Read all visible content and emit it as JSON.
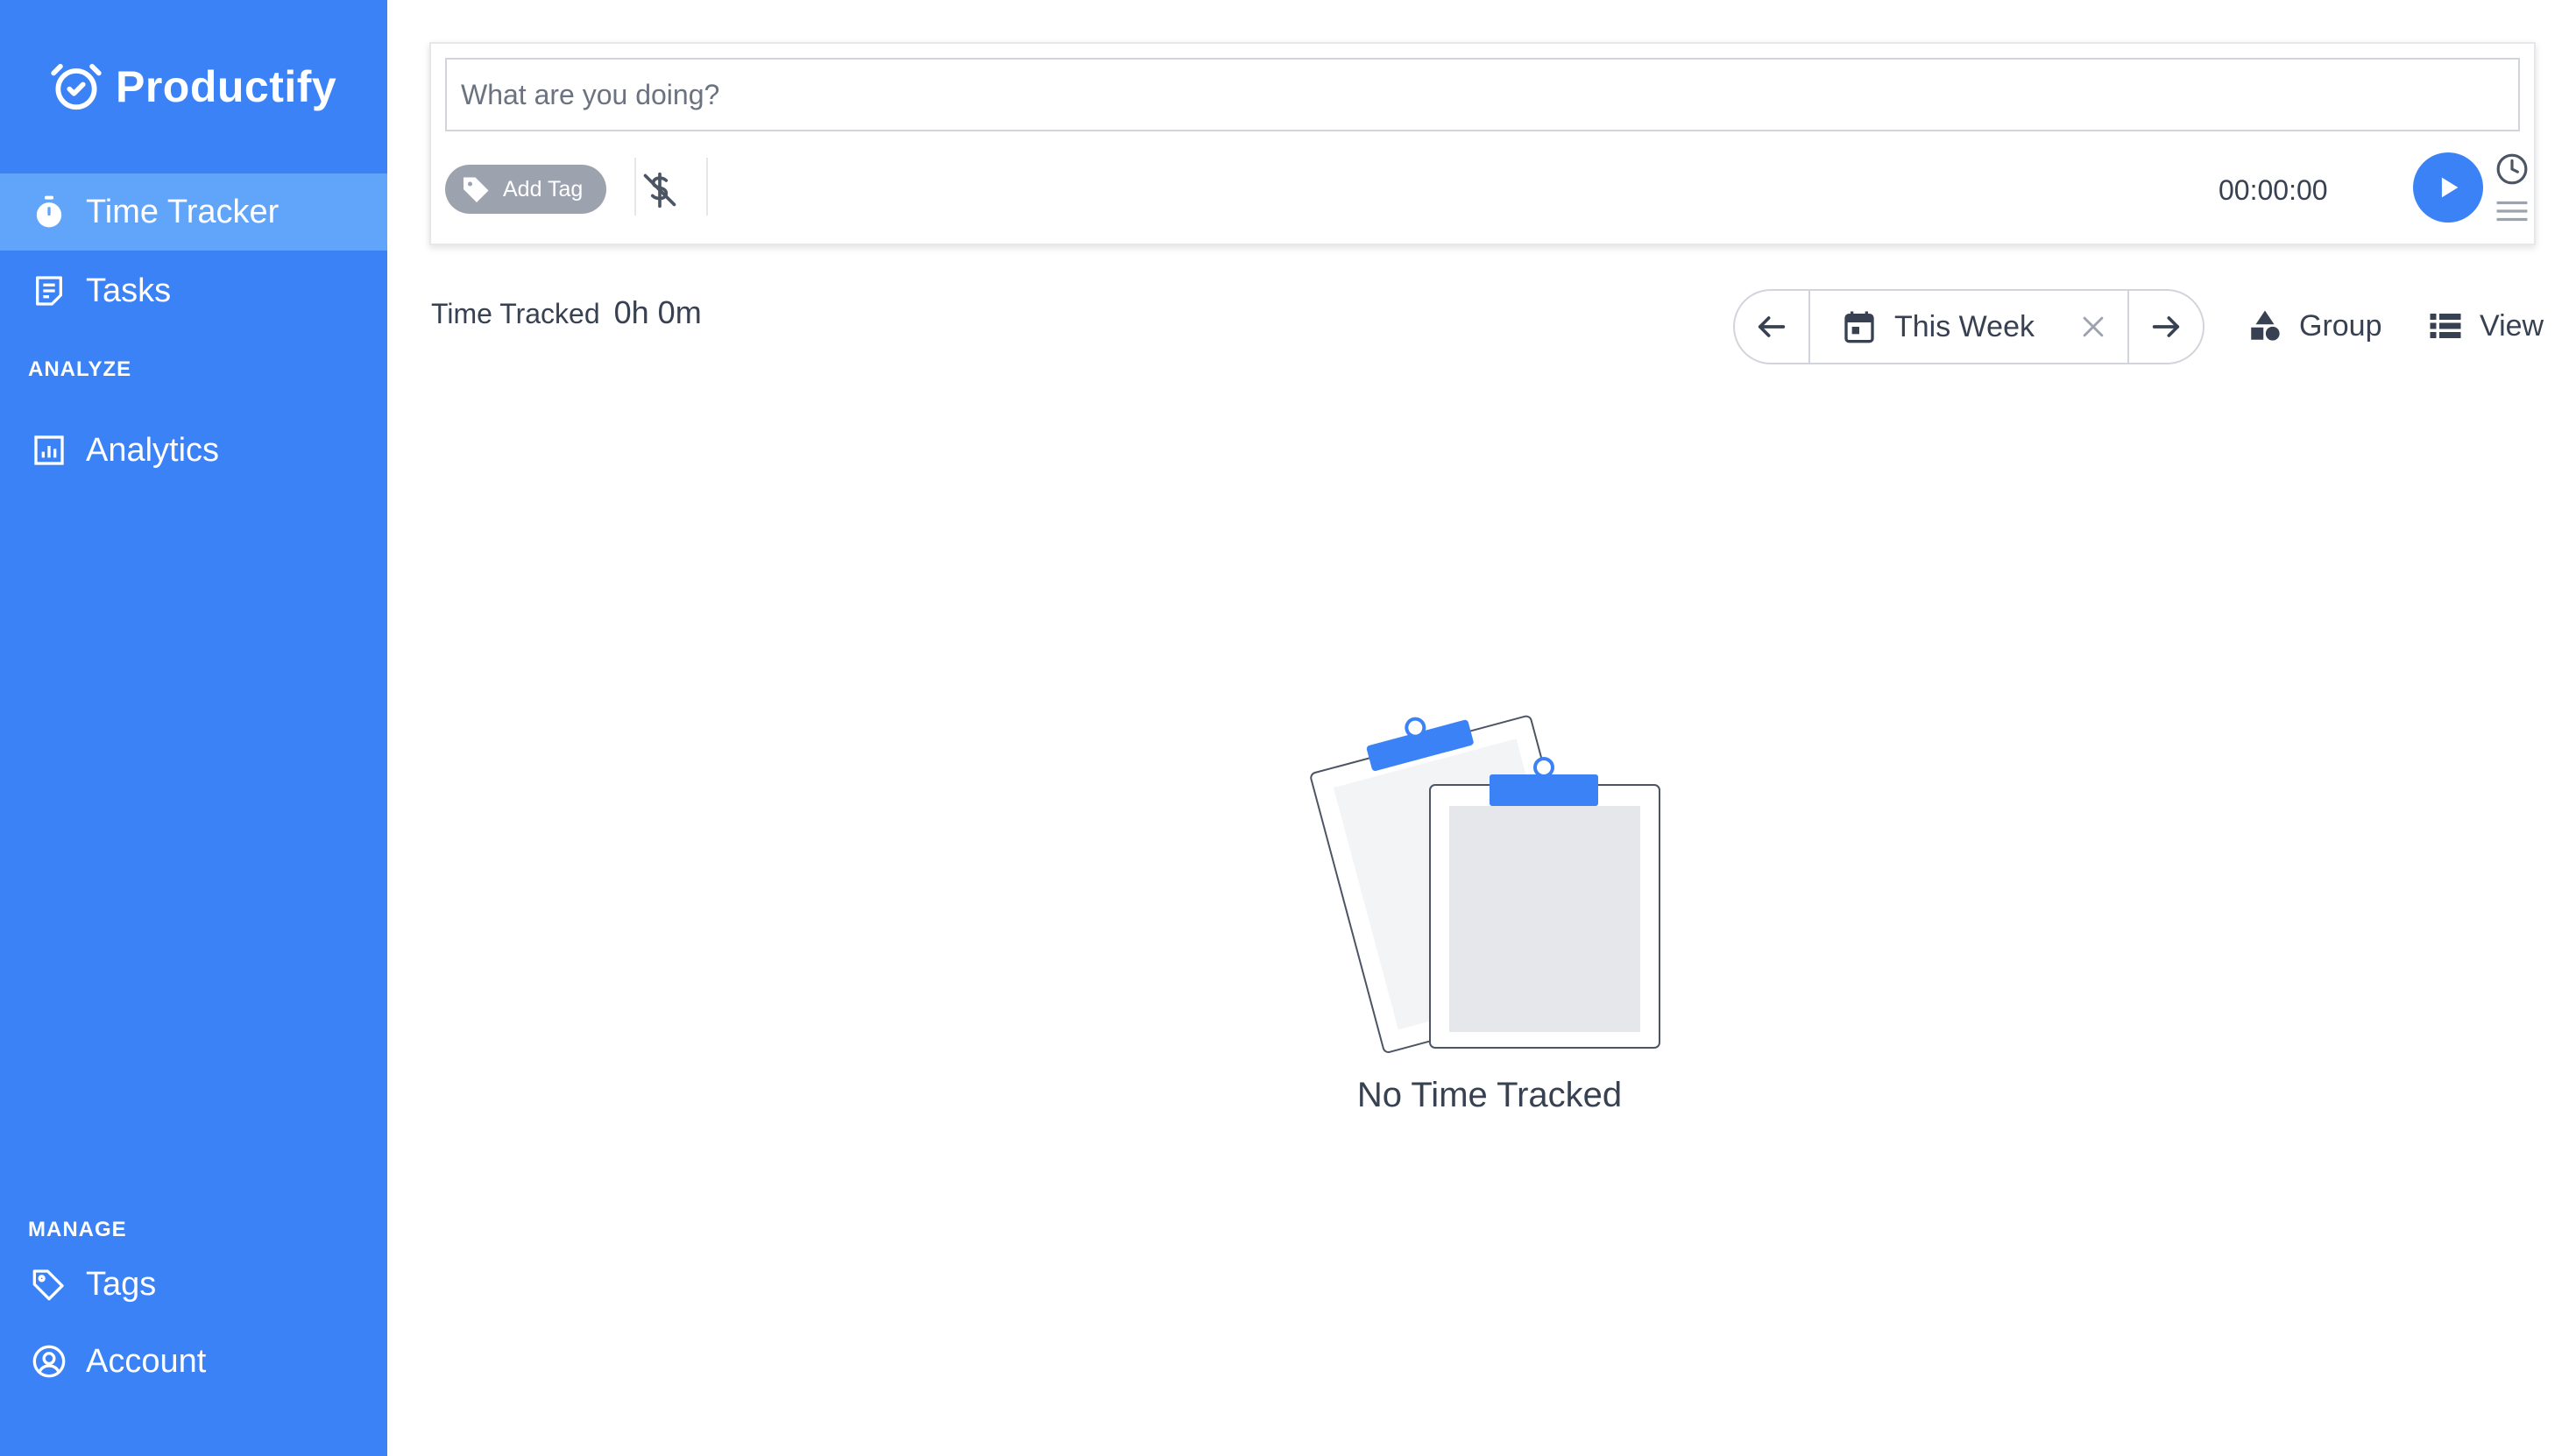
{
  "brand": {
    "name": "Productify",
    "icon": "alarm-clock-check-icon"
  },
  "sidebar": {
    "nav": [
      {
        "label": "Time Tracker",
        "icon": "stopwatch-icon",
        "active": true
      },
      {
        "label": "Tasks",
        "icon": "task-list-icon",
        "active": false
      }
    ],
    "analyze": {
      "heading": "ANALYZE",
      "items": [
        {
          "label": "Analytics",
          "icon": "bar-chart-icon"
        }
      ]
    },
    "manage": {
      "heading": "MANAGE",
      "items": [
        {
          "label": "Tags",
          "icon": "tag-icon"
        },
        {
          "label": "Account",
          "icon": "user-circle-icon"
        }
      ]
    }
  },
  "tracker": {
    "input_placeholder": "What are you doing?",
    "input_value": "",
    "add_tag_label": "Add Tag",
    "billable_icon": "dollar-off-icon",
    "timer": "00:00:00",
    "play_icon": "play-icon",
    "mode_icons": [
      "clock-icon",
      "list-icon"
    ]
  },
  "summary": {
    "tracked_label": "Time Tracked",
    "tracked_value": "0h 0m",
    "range_label": "This Week",
    "group_label": "Group",
    "view_label": "View"
  },
  "empty_state": {
    "message": "No Time Tracked",
    "illustration": "clipboard-illustration"
  },
  "colors": {
    "primary": "#3b82f6",
    "sidebar_active": "#60a5fa",
    "tag_chip": "#9ca3af",
    "text": "#374151"
  }
}
